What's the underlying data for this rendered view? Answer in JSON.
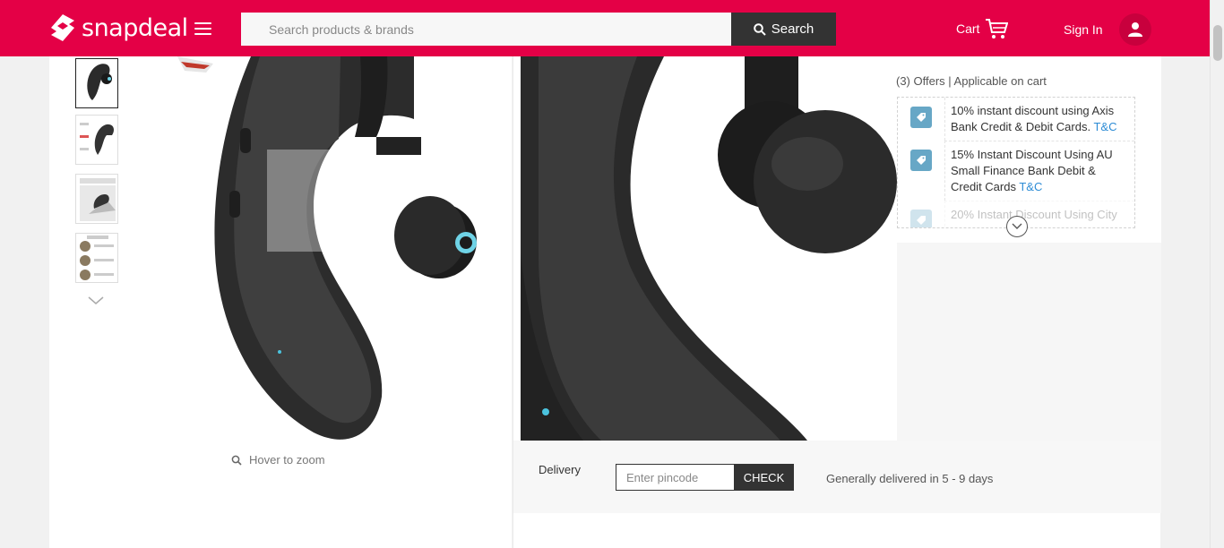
{
  "header": {
    "brand": "snapdeal",
    "search_placeholder": "Search products & brands",
    "search_button": "Search",
    "cart_label": "Cart",
    "signin_label": "Sign In",
    "colors": {
      "brand": "#e40046",
      "dark": "#333333"
    }
  },
  "gallery": {
    "thumbnails": [
      {
        "name": "thumbnail-1",
        "active": true
      },
      {
        "name": "thumbnail-2",
        "active": false
      },
      {
        "name": "thumbnail-3",
        "active": false
      },
      {
        "name": "thumbnail-4",
        "active": false
      }
    ],
    "hover_hint": "Hover to zoom"
  },
  "offers": {
    "title": "(3) Offers | Applicable on cart",
    "items": [
      {
        "text": "10% instant discount using Axis Bank Credit & Debit Cards.",
        "tc": "T&C"
      },
      {
        "text": "15% Instant Discount Using AU Small Finance Bank Debit & Credit Cards",
        "tc": "T&C"
      },
      {
        "text": "20% Instant Discount Using City",
        "tc": ""
      }
    ]
  },
  "delivery": {
    "label": "Delivery",
    "pincode_placeholder": "Enter pincode",
    "check_button": "CHECK",
    "info": "Generally delivered in 5 - 9 days"
  }
}
